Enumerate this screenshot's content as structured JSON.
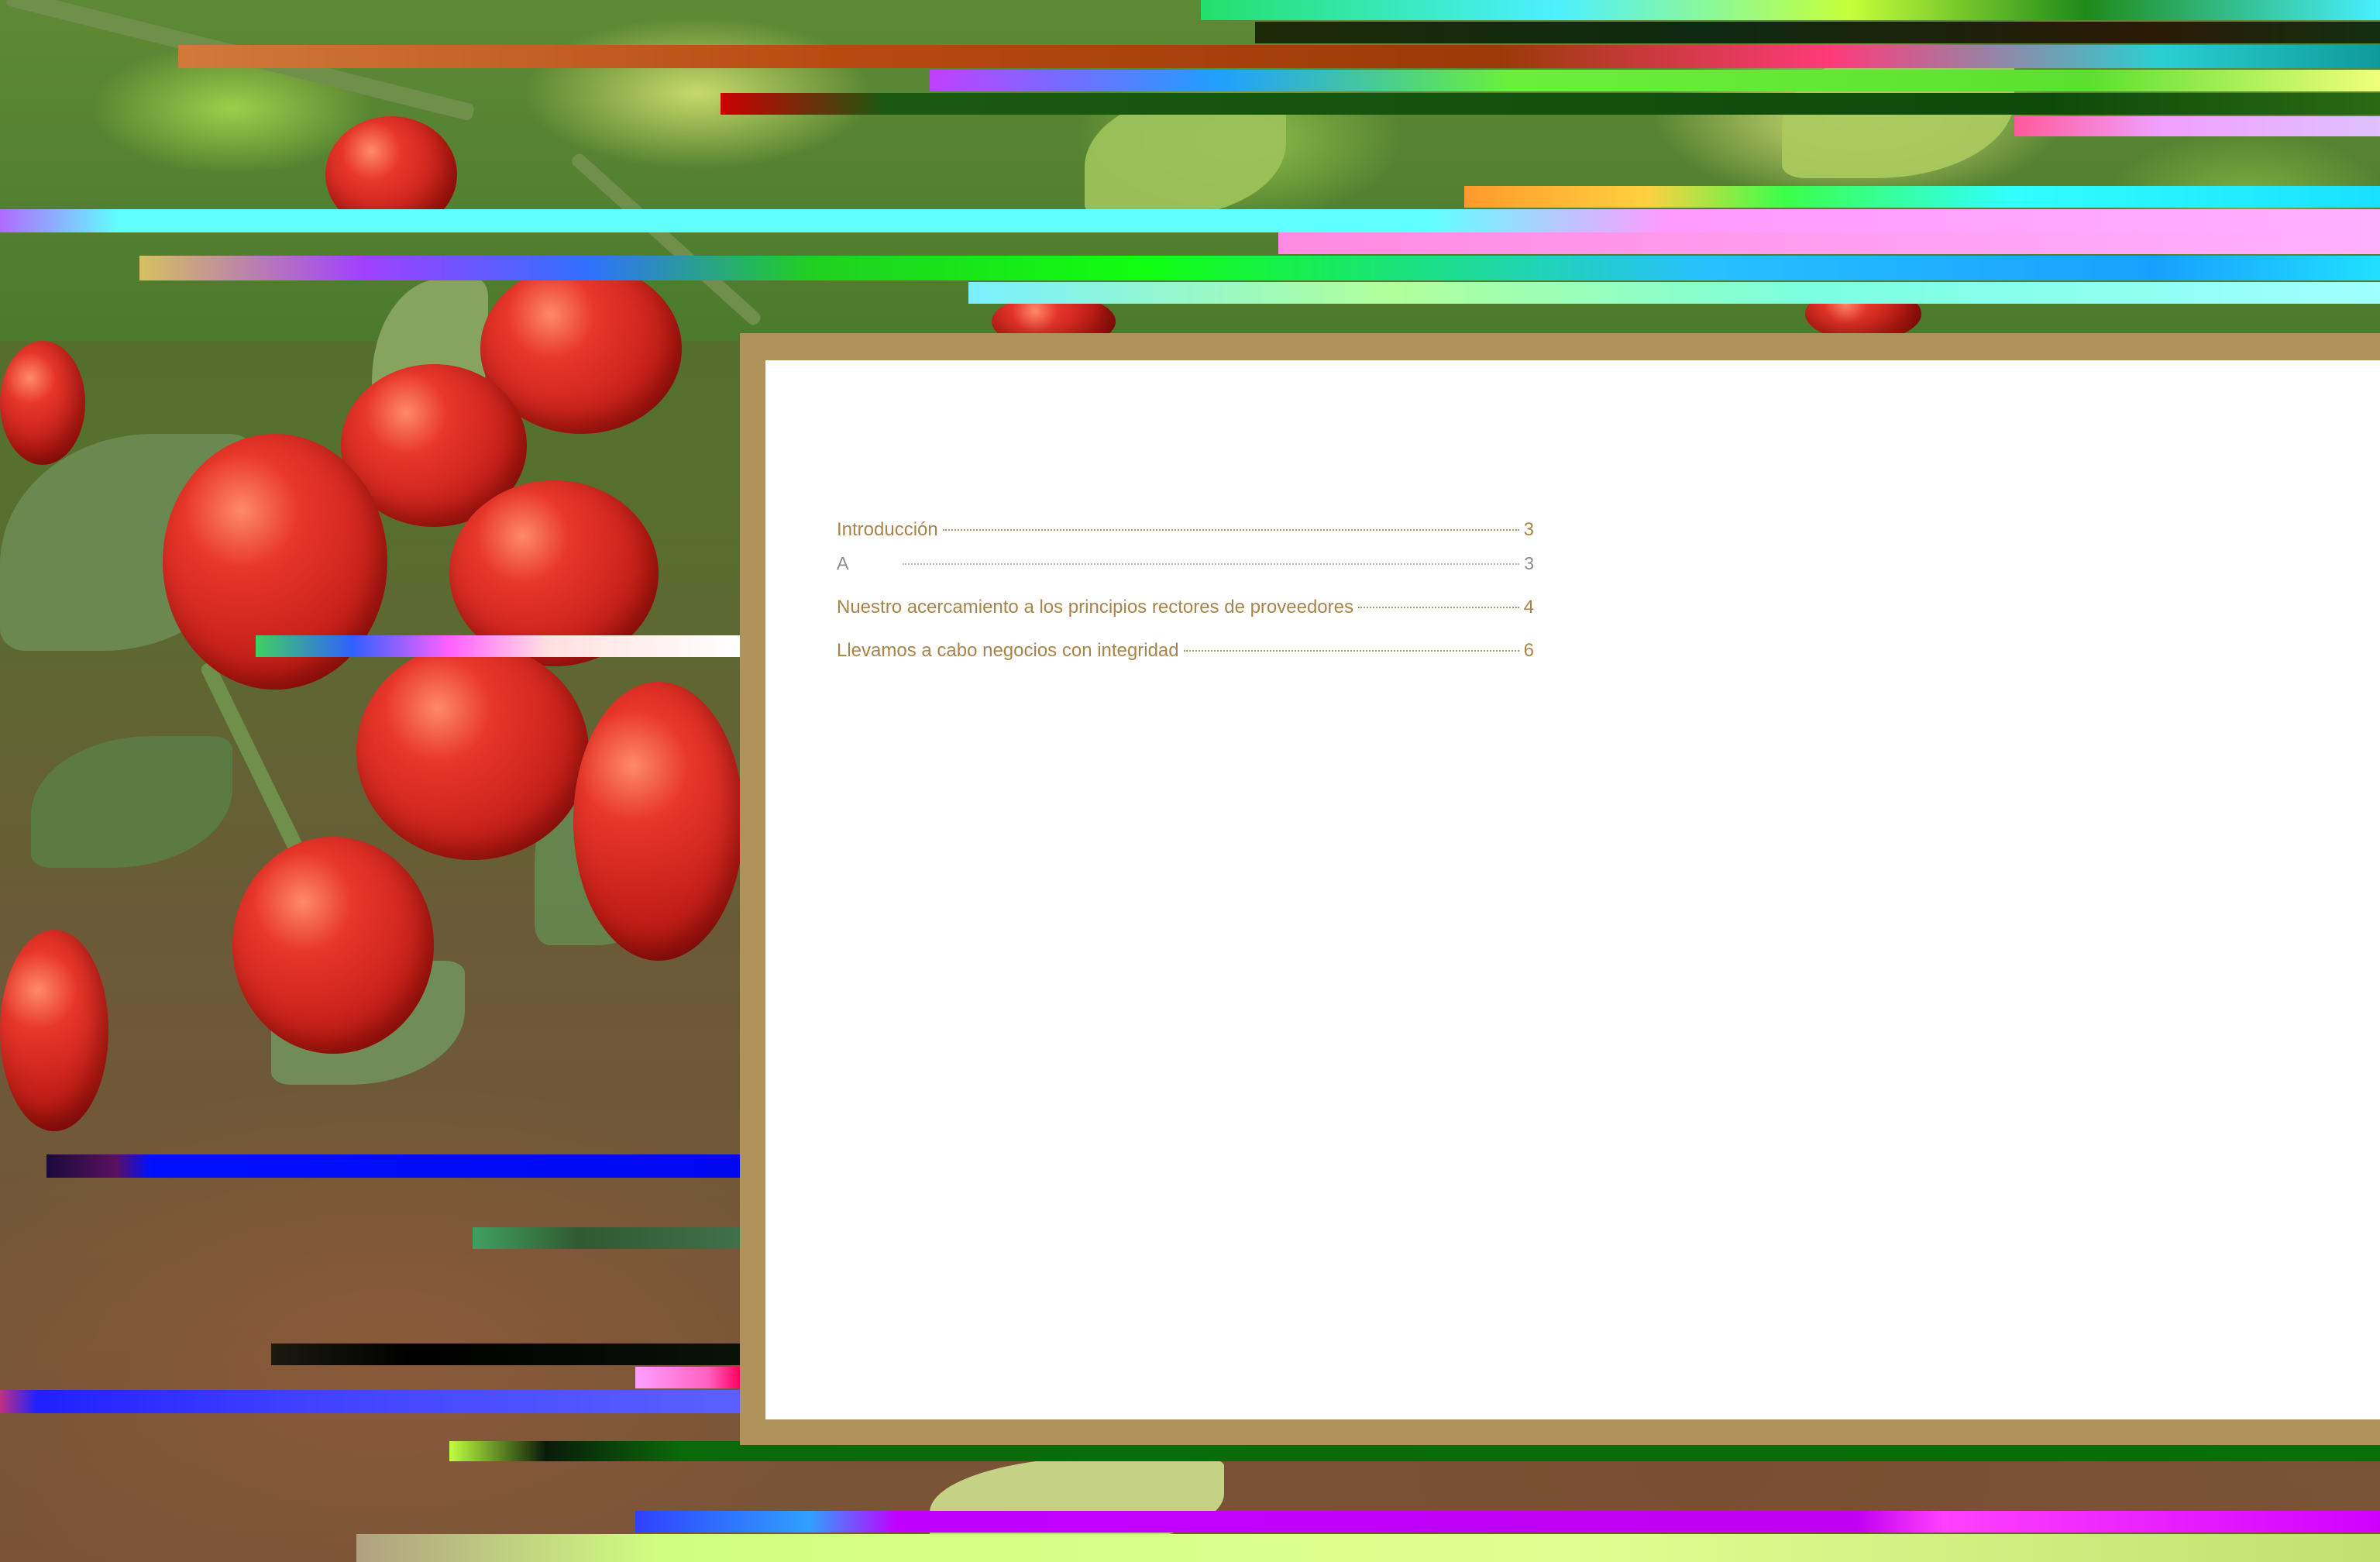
{
  "toc": {
    "entries": [
      {
        "label": "Introducción",
        "page": "3"
      },
      {
        "label": "A",
        "page": "3"
      },
      {
        "label": "Nuestro acercamiento a los principios rectores de proveedores",
        "page": "4"
      },
      {
        "label": "Llevamos a cabo negocios con integridad",
        "page": "6"
      }
    ]
  },
  "colors": {
    "accent": "#a8844a",
    "frame": "#b0935a",
    "muted_text": "#8c8c8c"
  }
}
